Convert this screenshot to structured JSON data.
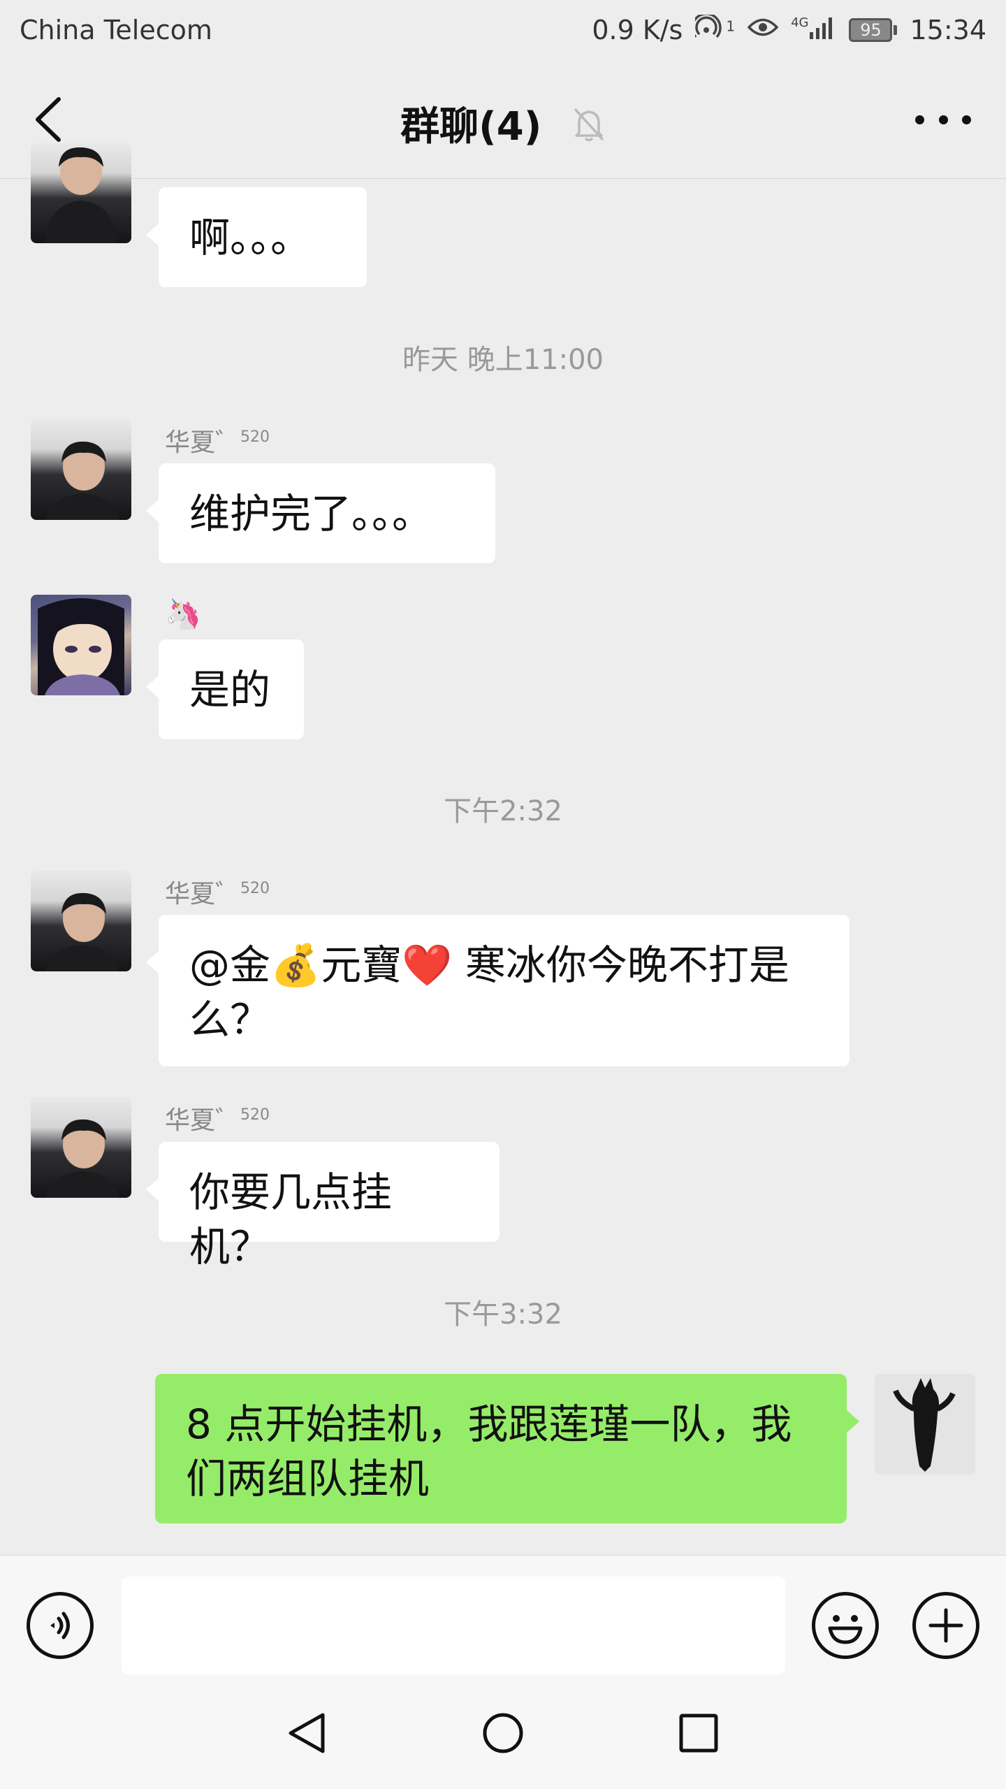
{
  "status_bar": {
    "carrier": "China Telecom",
    "speed": "0.9 K/s",
    "hotspot_sup": "1",
    "network": "4G",
    "battery": "95",
    "time": "15:34"
  },
  "header": {
    "title": "群聊(4)",
    "muted": true
  },
  "messages": {
    "m1": {
      "text": "啊。。。"
    },
    "ts1": "昨天 晚上11:00",
    "m2": {
      "sender_name": "华夏゛",
      "sender_sup": "520",
      "text": "维护完了。。。"
    },
    "m3": {
      "sender_emoji": "🦄",
      "text": "是的"
    },
    "ts2": "下午2:32",
    "m4": {
      "sender_name": "华夏゛",
      "sender_sup": "520",
      "text": "@金💰元寶❤️  寒冰你今晚不打是么？"
    },
    "m5": {
      "sender_name": "华夏゛",
      "sender_sup": "520",
      "text": "你要几点挂机？"
    },
    "ts3": "下午3:32",
    "m6": {
      "text": "8 点开始挂机，我跟莲瑾一队，我们两组队挂机"
    }
  },
  "input_bar": {
    "value": "",
    "icons": [
      "voice-icon",
      "emoji-icon",
      "plus-icon"
    ]
  },
  "nav_bar": {
    "icons": [
      "back-icon",
      "home-icon",
      "recents-icon"
    ]
  },
  "colors": {
    "background": "#ededed",
    "my_bubble": "#95ec69",
    "other_bubble": "#ffffff",
    "timestamp": "#999999"
  }
}
